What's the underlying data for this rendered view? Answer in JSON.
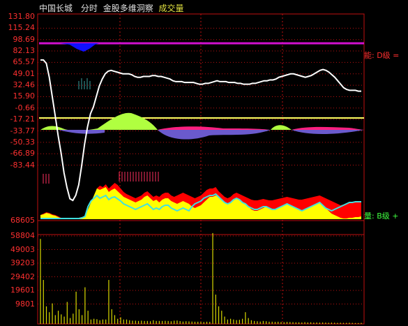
{
  "header": {
    "stock_name": "中国长城",
    "period": "分时",
    "indicator": "金股多维洞察",
    "volume_label": "成交量"
  },
  "colors": {
    "background": "#000000",
    "axis_text": "#ff3030",
    "grid": "#c01010",
    "price_line": "#ffffff",
    "yellow_area": "#ffff00",
    "red_area": "#ff0000",
    "cyan_line": "#40e0e0",
    "lime_area": "#b0ff40",
    "purple_area": "#6a5acd",
    "magenta_area": "#ff2080",
    "blue_area": "#1010ff",
    "magenta_line": "#d010d0",
    "volume_bar": "#d8d800"
  },
  "side_labels": {
    "energy": "能: D级 =",
    "volume": "量: B级 +"
  },
  "main_axis": {
    "labels": [
      "131.80",
      "115.24",
      "98.69",
      "82.13",
      "65.57",
      "49.01",
      "32.46",
      "15.90",
      "-0.66",
      "-17.21",
      "-33.77",
      "-50.33",
      "-66.89",
      "-83.44"
    ]
  },
  "volume_axis": {
    "labels": [
      "68605",
      "58804",
      "49003",
      "39203",
      "29402",
      "19601",
      "9801"
    ]
  },
  "chart_data": {
    "type": "line",
    "description_series": [
      {
        "name": "white-line",
        "values": [
          82,
          82,
          78,
          62,
          40,
          18,
          -5,
          -25,
          -48,
          -65,
          -78,
          -80,
          -74,
          -62,
          -40,
          -15,
          5,
          20,
          28,
          40,
          52,
          60,
          66,
          69,
          70,
          69,
          68,
          67,
          66,
          66,
          66,
          65,
          63,
          62,
          62,
          63,
          63,
          63,
          64,
          64,
          63,
          63,
          62,
          61,
          60,
          58,
          57,
          57,
          57,
          56,
          56,
          56,
          56,
          55,
          54,
          54,
          55,
          55,
          56,
          57,
          58,
          57,
          57,
          57,
          56,
          56,
          56,
          55,
          55,
          54,
          54,
          54,
          55,
          55,
          56,
          57,
          58,
          58,
          59,
          59,
          60,
          62,
          63,
          64,
          65,
          66,
          66,
          65,
          64,
          63,
          62,
          63,
          64,
          66,
          68,
          70,
          71,
          70,
          68,
          65,
          62,
          58,
          54,
          50,
          48,
          47,
          47,
          47,
          46,
          46
        ]
      }
    ],
    "ylim": [
      -100,
      131.8
    ],
    "volume_values": [
      58000,
      30000,
      12000,
      8000,
      14000,
      6000,
      9000,
      6500,
      5000,
      15000,
      4000,
      7000,
      22000,
      10000,
      6000,
      25000,
      9000,
      3000,
      3500,
      3200,
      2500,
      3000,
      3000,
      30000,
      10000,
      6000,
      3500,
      4500,
      3000,
      3000,
      2500,
      2200,
      2200,
      2000,
      2200,
      2000,
      2000,
      1800,
      2500,
      2000,
      2000,
      2000,
      2100,
      2000,
      1800,
      2200,
      2300,
      1900,
      1600,
      1800,
      1700,
      1600,
      1500,
      1500,
      1400,
      1300,
      1500,
      1400,
      62000,
      20000,
      12000,
      9000,
      5000,
      3000,
      3500,
      3000,
      2600,
      2800,
      3500,
      8000,
      4000,
      2500,
      2000,
      1800,
      1600,
      2000,
      1800,
      1500,
      1500,
      1400,
      1500,
      1300,
      1200,
      1400,
      1300,
      1200,
      1100,
      1100,
      1000,
      1200,
      1000,
      1100,
      900,
      1000,
      900,
      1000,
      900,
      800,
      900,
      800,
      700,
      800,
      700,
      700,
      800,
      700,
      600,
      600,
      700
    ]
  }
}
